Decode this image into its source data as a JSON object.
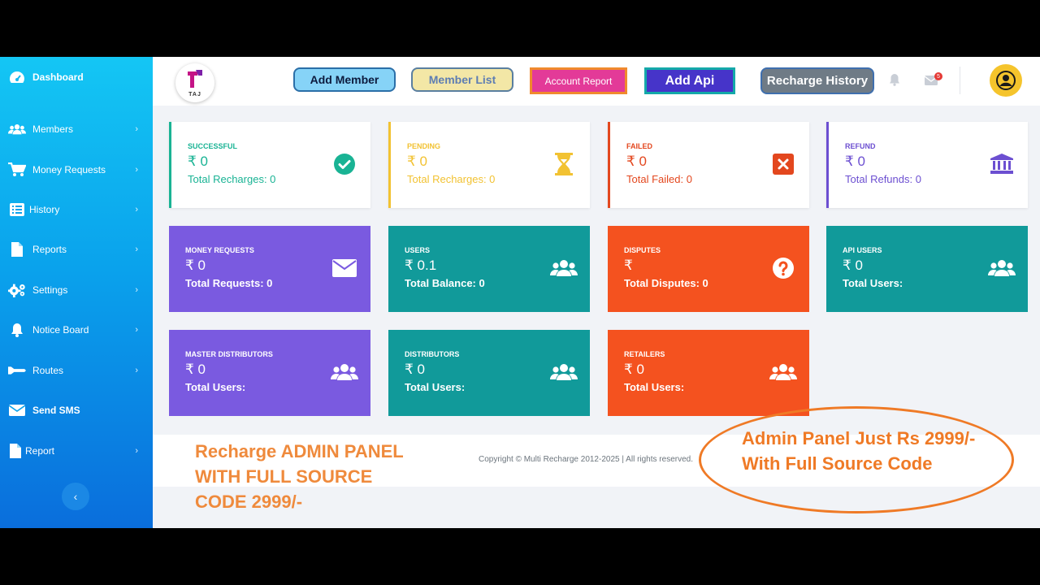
{
  "sidebar": {
    "items": [
      {
        "label": "Dashboard",
        "icon": "dashboard-icon",
        "chevron": ""
      },
      {
        "label": "Members",
        "icon": "users-icon",
        "chevron": "›"
      },
      {
        "label": "Money Requests",
        "icon": "cart-icon",
        "chevron": "›"
      },
      {
        "label": "History",
        "icon": "list-icon",
        "chevron": "›"
      },
      {
        "label": "Reports",
        "icon": "file-icon",
        "chevron": "›"
      },
      {
        "label": "Settings",
        "icon": "gears-icon",
        "chevron": "›"
      },
      {
        "label": "Notice Board",
        "icon": "bell-icon",
        "chevron": "›"
      },
      {
        "label": "Routes",
        "icon": "route-icon",
        "chevron": "›"
      },
      {
        "label": "Send SMS",
        "icon": "envelope-icon",
        "chevron": ""
      },
      {
        "label": "Report",
        "icon": "file-icon",
        "chevron": "›"
      }
    ],
    "collapse": "‹"
  },
  "header": {
    "logo_text": "TAJ",
    "add_member": "Add Member",
    "member_list": "Member List",
    "account_report": "Account Report",
    "add_api": "Add Api",
    "recharge_history": "Recharge History",
    "mail_count": "5"
  },
  "cards": [
    {
      "title": "SUCCESSFUL",
      "amount": "₹ 0",
      "sub": "Total Recharges: 0",
      "icon": "check-circle-icon",
      "color": "#19b394"
    },
    {
      "title": "PENDING",
      "amount": "₹ 0",
      "sub": "Total Recharges: 0",
      "icon": "hourglass-icon",
      "color": "#f2c232"
    },
    {
      "title": "FAILED",
      "amount": "₹ 0",
      "sub": "Total Failed: 0",
      "icon": "close-box-icon",
      "color": "#e3471e"
    },
    {
      "title": "REFUND",
      "amount": "₹ 0",
      "sub": "Total Refunds: 0",
      "icon": "bank-icon",
      "color": "#6c4fd1"
    },
    {
      "title": "MONEY REQUESTS",
      "amount": "₹ 0",
      "sub": "Total Requests: 0",
      "icon": "envelope-icon",
      "color": "#7a5ae0"
    },
    {
      "title": "USERS",
      "amount": "₹ 0.1",
      "sub": "Total Balance: 0",
      "icon": "users-icon",
      "color": "#119a9a"
    },
    {
      "title": "DISPUTES",
      "amount": "₹",
      "sub": "Total Disputes: 0",
      "icon": "question-circle-icon",
      "color": "#f4521f"
    },
    {
      "title": "API USERS",
      "amount": "₹ 0",
      "sub": "Total Users:",
      "icon": "users-icon",
      "color": "#119a9a"
    },
    {
      "title": "MASTER DISTRIBUTORS",
      "amount": "₹ 0",
      "sub": "Total Users:",
      "icon": "users-icon",
      "color": "#7a5ae0"
    },
    {
      "title": "DISTRIBUTORS",
      "amount": "₹ 0",
      "sub": "Total Users:",
      "icon": "users-icon",
      "color": "#119a9a"
    },
    {
      "title": "RETAILERS",
      "amount": "₹ 0",
      "sub": "Total Users:",
      "icon": "users-icon",
      "color": "#f4521f"
    }
  ],
  "footer": {
    "copyright": "Copyright © Multi Recharge 2012-2025 | All rights reserved."
  },
  "promo": {
    "left_line1": "Recharge ADMIN PANEL",
    "left_line2": "WITH FULL SOURCE",
    "left_line3": "CODE 2999/-",
    "right_line1": "Admin Panel Just Rs 2999/-",
    "right_line2": "With Full Source Code"
  }
}
